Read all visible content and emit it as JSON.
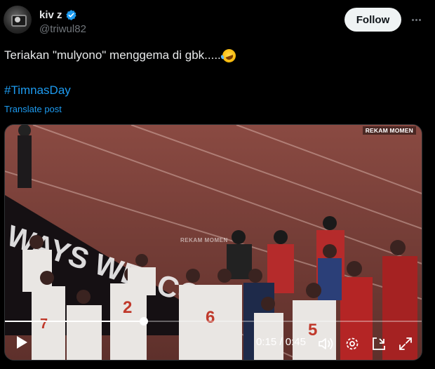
{
  "author": {
    "display_name": "kiv z",
    "handle": "@triwul82"
  },
  "actions": {
    "follow_label": "Follow"
  },
  "post": {
    "text": "Teriakan \"mulyono\" menggema di gbk.....",
    "emoji": "rolling-on-floor-laughing",
    "hashtag": "#TimnasDay",
    "translate_label": "Translate post"
  },
  "video": {
    "watermark_top": "REKAM MOMEN",
    "watermark_center": "REKAM MOMEN",
    "current_time": "0:15",
    "duration": "0:45",
    "progress": 0.333,
    "controls": [
      "play-icon",
      "volume-icon",
      "settings-icon",
      "pip-icon",
      "fullscreen-icon"
    ]
  },
  "colors": {
    "background": "#000000",
    "link": "#1d9bf0",
    "verified": "#1d9bf0",
    "follow_bg": "#eff3f4",
    "secondary_text": "#71767b"
  }
}
